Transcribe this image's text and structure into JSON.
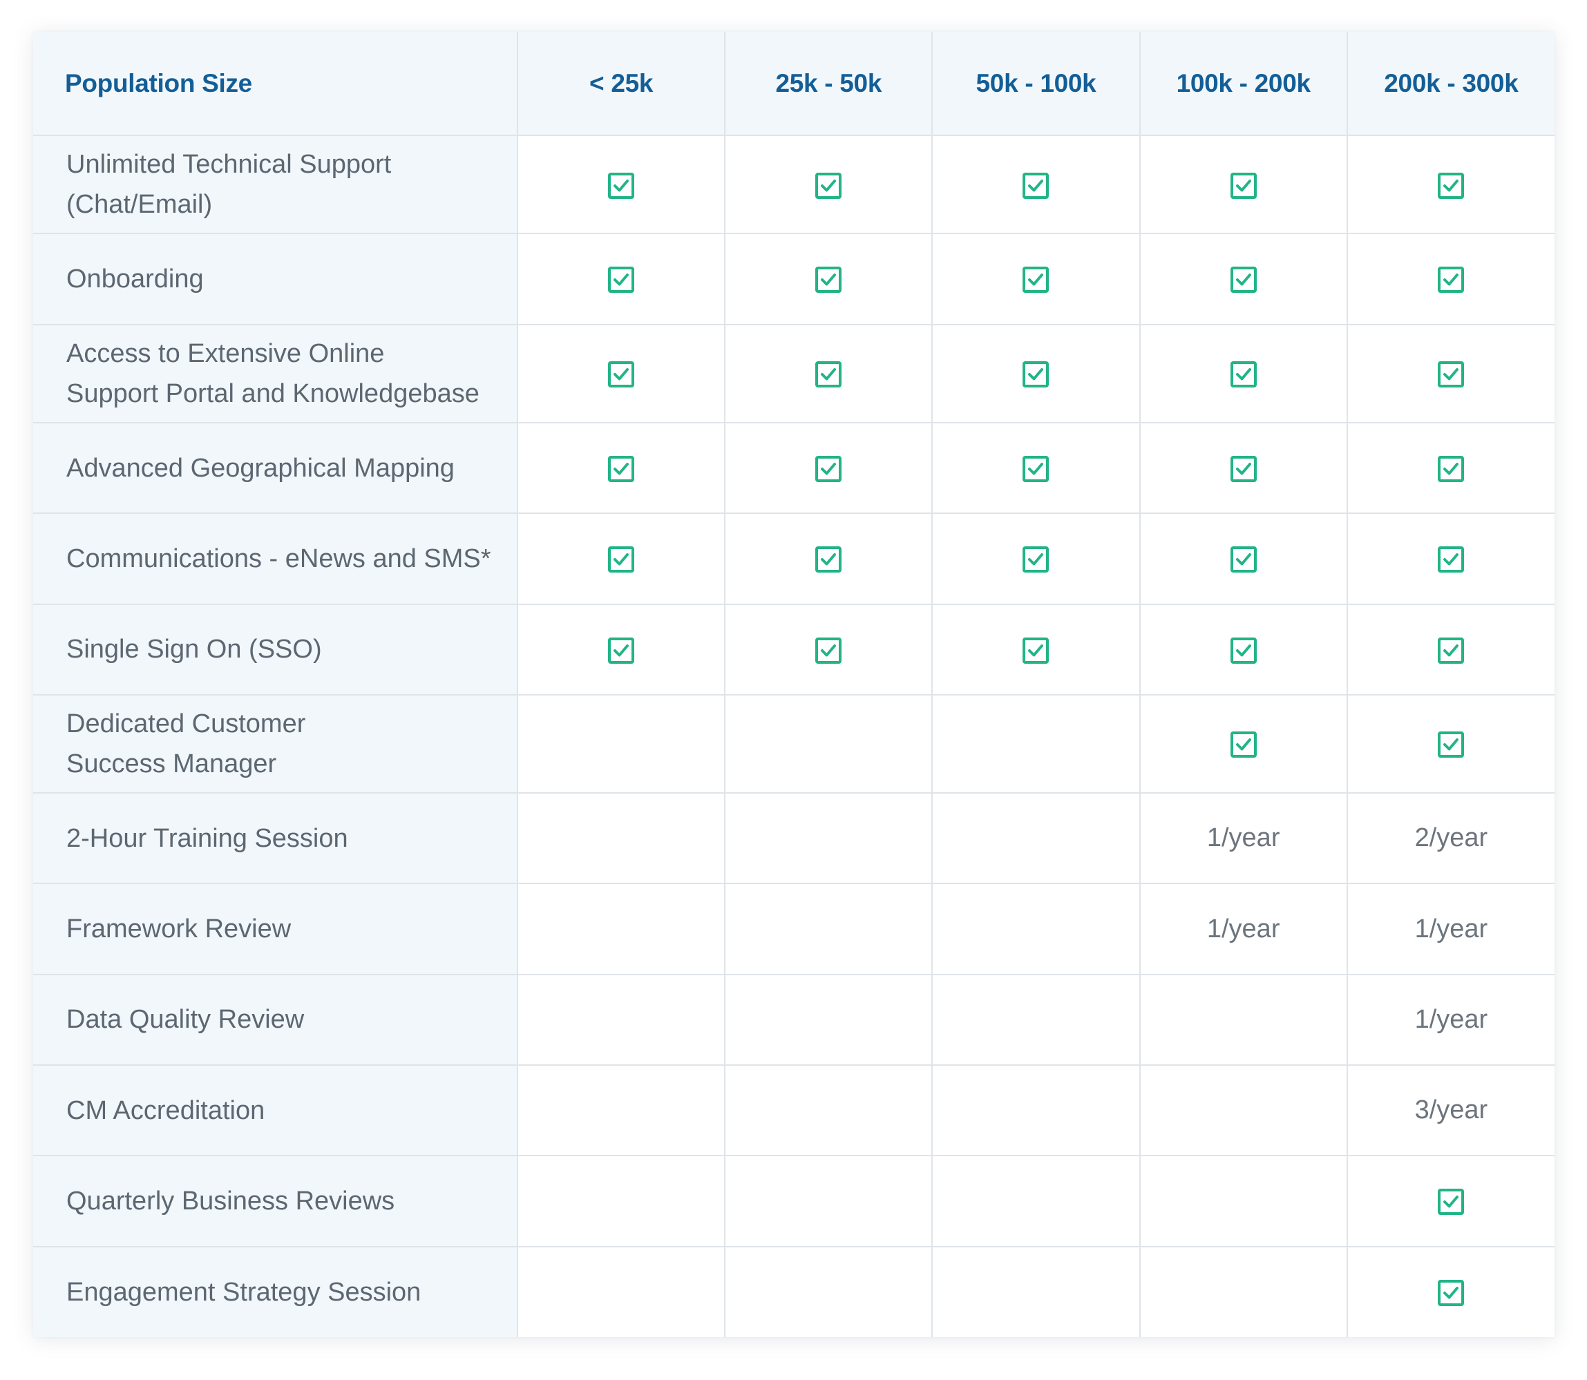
{
  "table": {
    "header": {
      "feature_label": "Population Size",
      "tiers": [
        "< 25k",
        "25k - 50k",
        "50k  - 100k",
        "100k - 200k",
        "200k - 300k"
      ]
    },
    "rows": [
      {
        "feature": [
          "Unlimited Technical Support",
          "(Chat/Email)"
        ],
        "cells": [
          "check",
          "check",
          "check",
          "check",
          "check"
        ]
      },
      {
        "feature": [
          "Onboarding"
        ],
        "cells": [
          "check",
          "check",
          "check",
          "check",
          "check"
        ]
      },
      {
        "feature": [
          "Access to Extensive Online",
          "Support Portal and Knowledgebase"
        ],
        "cells": [
          "check",
          "check",
          "check",
          "check",
          "check"
        ]
      },
      {
        "feature": [
          "Advanced Geographical Mapping"
        ],
        "cells": [
          "check",
          "check",
          "check",
          "check",
          "check"
        ]
      },
      {
        "feature": [
          "Communications - eNews and SMS*"
        ],
        "cells": [
          "check",
          "check",
          "check",
          "check",
          "check"
        ]
      },
      {
        "feature": [
          "Single Sign On (SSO)"
        ],
        "cells": [
          "check",
          "check",
          "check",
          "check",
          "check"
        ]
      },
      {
        "feature": [
          "Dedicated Customer",
          "Success Manager"
        ],
        "cells": [
          "",
          "",
          "",
          "check",
          "check"
        ]
      },
      {
        "feature": [
          "2-Hour Training Session"
        ],
        "cells": [
          "",
          "",
          "",
          "1/year",
          "2/year"
        ]
      },
      {
        "feature": [
          "Framework Review"
        ],
        "cells": [
          "",
          "",
          "",
          "1/year",
          "1/year"
        ]
      },
      {
        "feature": [
          "Data Quality Review"
        ],
        "cells": [
          "",
          "",
          "",
          "",
          "1/year"
        ]
      },
      {
        "feature": [
          "CM Accreditation"
        ],
        "cells": [
          "",
          "",
          "",
          "",
          "3/year"
        ]
      },
      {
        "feature": [
          "Quarterly Business Reviews"
        ],
        "cells": [
          "",
          "",
          "",
          "",
          "check"
        ]
      },
      {
        "feature": [
          "Engagement Strategy Session"
        ],
        "cells": [
          "",
          "",
          "",
          "",
          "check"
        ]
      }
    ]
  },
  "icons": {
    "included": "checked-box-icon"
  },
  "colors": {
    "header_text": "#135e96",
    "feature_text": "#5d6771",
    "check": "#22b486",
    "stripe": "#f2f7fb",
    "grid": "#dfe4e9"
  }
}
